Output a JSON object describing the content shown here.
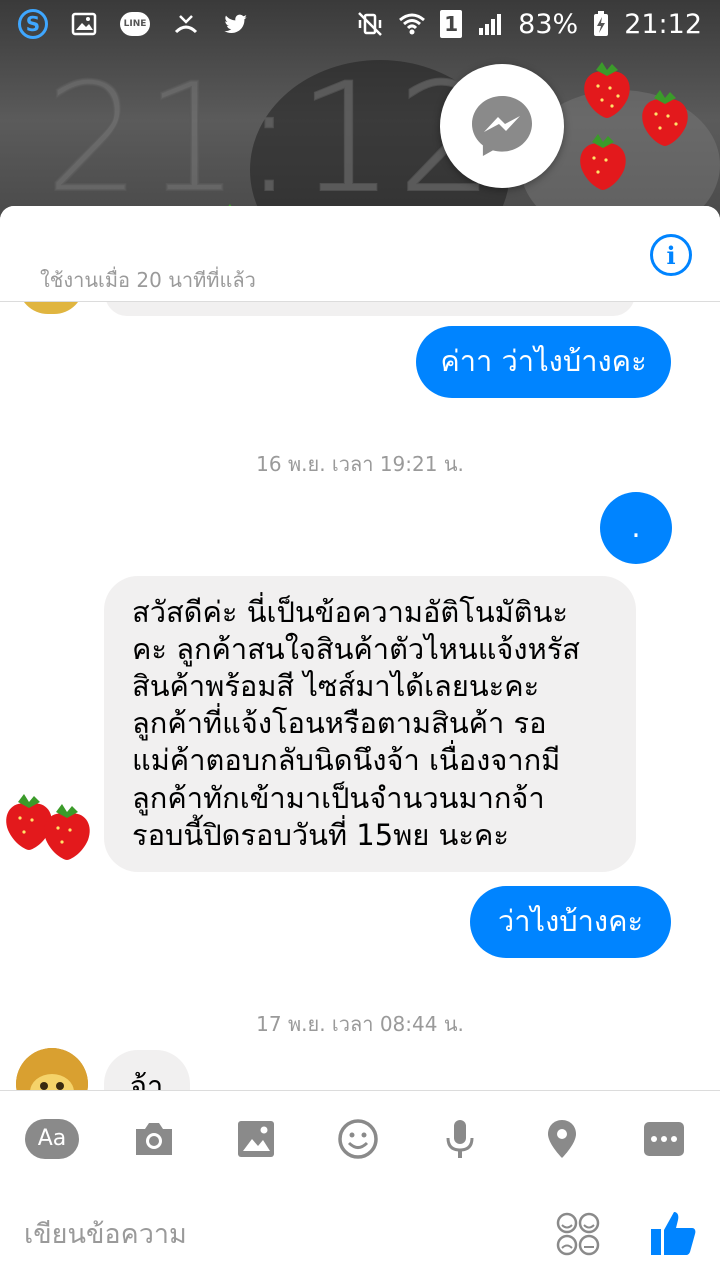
{
  "status_bar": {
    "battery": "83%",
    "time": "21:12",
    "sim": "1"
  },
  "lockscreen": {
    "clock": "21:12"
  },
  "chat": {
    "header_subtitle": "ใช้งานเมื่อ 20 นาทีที่แล้ว",
    "messages": [
      {
        "from": "me",
        "text": "ค่าา ว่าไงบ้างคะ"
      },
      {
        "type": "timestamp",
        "text": "16 พ.ย. เวลา 19:21 น."
      },
      {
        "from": "me",
        "text": "."
      },
      {
        "from": "them",
        "lines": [
          "สวัสดีค่ะ นี่เป็นข้อความอัติโนมัตินะ",
          "คะ ลูกค้าสนใจสินค้าตัวไหนแจ้งหรัส",
          "สินค้าพร้อมสี ไซส์มาได้เลยนะคะ",
          "ลูกค้าที่แจ้งโอนหรือตามสินค้า รอ",
          "แม่ค้าตอบกลับนิดนึงจ้า เนื่องจากมี",
          "ลูกค้าทักเข้ามาเป็นจำนวนมากจ้า",
          "รอบนี้ปิดรอบวันที่ 15พย นะคะ"
        ]
      },
      {
        "from": "me",
        "text": "ว่าไงบ้างคะ"
      },
      {
        "type": "timestamp",
        "text": "17 พ.ย. เวลา 08:44 น."
      },
      {
        "from": "them",
        "text": "จ้า"
      }
    ]
  },
  "toolbar": {
    "items": [
      "text-style",
      "camera",
      "gallery",
      "emoji",
      "microphone",
      "location",
      "more"
    ],
    "aa_label": "Aa"
  },
  "composer": {
    "placeholder": "เขียนข้อความ"
  },
  "colors": {
    "accent": "#0084ff",
    "incoming_bubble": "#f1f0f0",
    "toolbar_icon": "#8a8a8a"
  }
}
